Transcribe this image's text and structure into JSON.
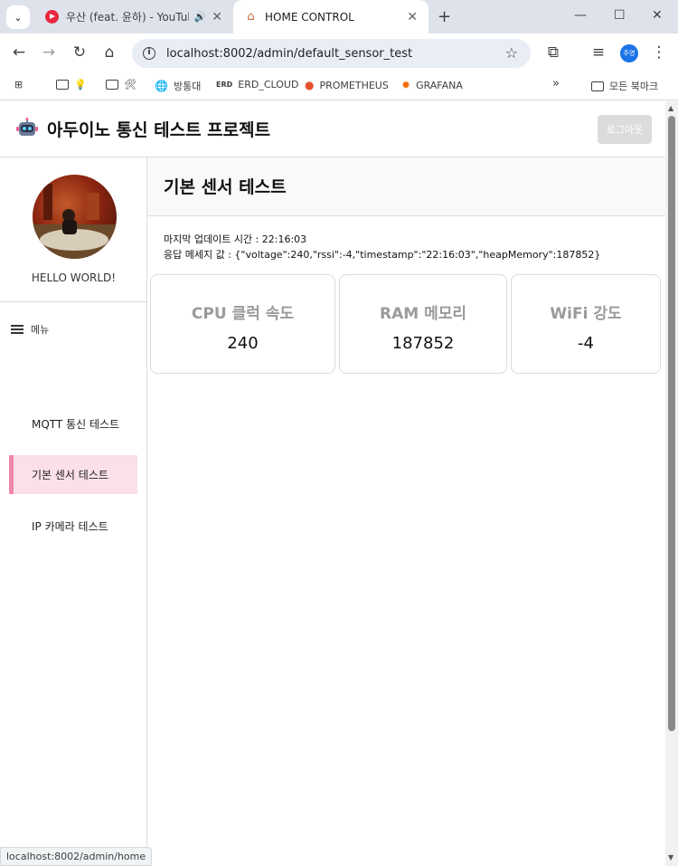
{
  "browser": {
    "tabs": [
      {
        "title": "우산 (feat. 윤하) - YouTube",
        "active": false
      },
      {
        "title": "HOME CONTROL",
        "active": true
      }
    ],
    "url": "localhost:8002/admin/default_sensor_test",
    "profile_initials": "주영",
    "bookmarks": [
      {
        "label": "💡",
        "icon": "folder-icon"
      },
      {
        "label": "🛠",
        "icon": "folder-icon"
      },
      {
        "label": "방통대",
        "icon": "globe-icon"
      },
      {
        "label": "ERD_CLOUD",
        "icon": "erd-icon",
        "prefix": "ERD"
      },
      {
        "label": "PROMETHEUS",
        "icon": "prometheus-icon"
      },
      {
        "label": "GRAFANA",
        "icon": "grafana-icon"
      }
    ],
    "all_bookmarks_label": "모든 북마크",
    "status_url": "localhost:8002/admin/home"
  },
  "app": {
    "title": "아두이노 통신 테스트 프로젝트",
    "logout_label": "로그아웃"
  },
  "sidebar": {
    "profile_name": "HELLO WORLD!",
    "menu_label": "메뉴",
    "items": [
      {
        "label": "MQTT 통신 테스트",
        "active": false
      },
      {
        "label": "기본 센서 테스트",
        "active": true
      },
      {
        "label": "IP 카메라 테스트",
        "active": false
      }
    ]
  },
  "main": {
    "title": "기본 센서 테스트",
    "last_update": "마지막 업데이트 시간 : 22:16:03",
    "response": "응답 메세지 값 : {\"voltage\":240,\"rssi\":-4,\"timestamp\":\"22:16:03\",\"heapMemory\":187852}",
    "cards": [
      {
        "label": "CPU 클럭 속도",
        "value": "240"
      },
      {
        "label": "RAM 메모리",
        "value": "187852"
      },
      {
        "label": "WiFi 강도",
        "value": "-4"
      }
    ]
  },
  "colors": {
    "active_nav_bg": "#fbe0e8",
    "active_nav_border": "#f086a8",
    "card_label": "#9a9a9a"
  }
}
